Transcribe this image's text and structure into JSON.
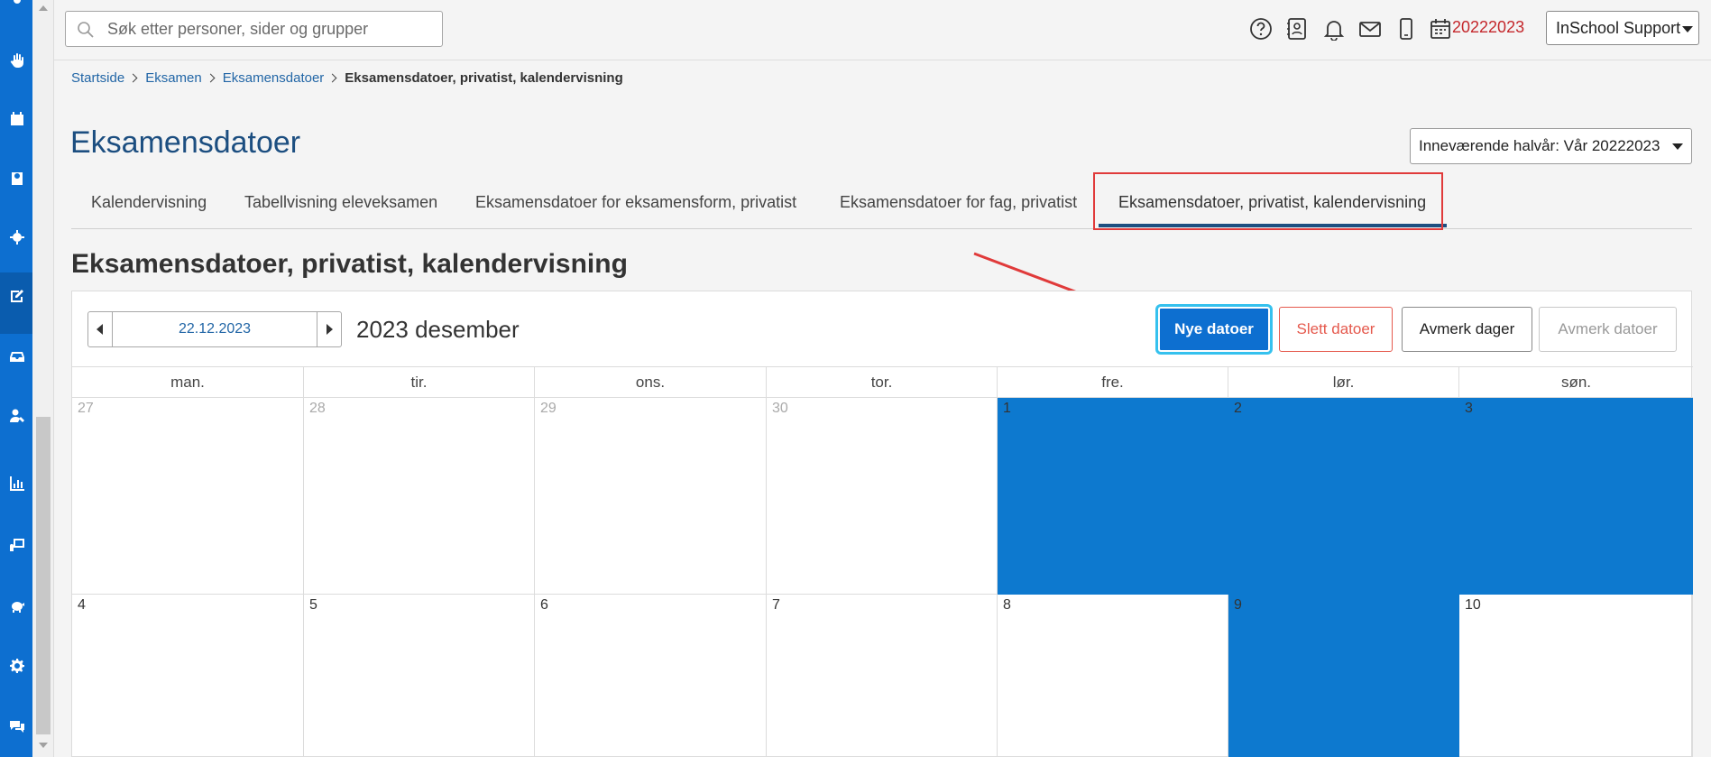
{
  "nav_rail": {
    "icons": [
      "person-raise-icon",
      "hand-icon",
      "calendar-icon",
      "student-book-icon",
      "virus-icon",
      "exam-edit-icon",
      "inbox-icon",
      "user-admin-icon",
      "chart-icon",
      "presentation-icon",
      "piggy-bank-icon",
      "gear-icon",
      "chat-icon"
    ],
    "active": "exam-edit-icon"
  },
  "header": {
    "search_placeholder": "Søk etter personer, sider og grupper",
    "icons": [
      "help-icon",
      "contacts-icon",
      "bell-icon",
      "mail-icon",
      "phone-icon",
      "calendar-icon"
    ],
    "school_year": "20222023",
    "user_menu": "InSchool Support"
  },
  "breadcrumb": {
    "items": [
      "Startside",
      "Eksamen",
      "Eksamensdatoer"
    ],
    "current": "Eksamensdatoer, privatist, kalendervisning"
  },
  "page": {
    "title": "Eksamensdatoer",
    "semester_select": "Inneværende halvår: Vår 20222023"
  },
  "tabs": [
    {
      "label": "Kalendervisning"
    },
    {
      "label": "Tabellvisning eleveksamen"
    },
    {
      "label": "Eksamensdatoer for eksamensform, privatist"
    },
    {
      "label": "Eksamensdatoer for fag, privatist"
    },
    {
      "label": "Eksamensdatoer, privatist, kalendervisning",
      "active": true
    }
  ],
  "section": {
    "title": "Eksamensdatoer, privatist, kalendervisning"
  },
  "calendar": {
    "date_value": "22.12.2023",
    "month_label": "2023 desember",
    "buttons": {
      "new": "Nye datoer",
      "delete": "Slett datoer",
      "mark_days": "Avmerk dager",
      "mark_dates": "Avmerk datoer"
    },
    "weekdays": [
      "man.",
      "tir.",
      "ons.",
      "tor.",
      "fre.",
      "lør.",
      "søn."
    ],
    "weeks": [
      [
        {
          "day": "27",
          "other": true,
          "selected": false
        },
        {
          "day": "28",
          "other": true,
          "selected": false
        },
        {
          "day": "29",
          "other": true,
          "selected": false
        },
        {
          "day": "30",
          "other": true,
          "selected": false
        },
        {
          "day": "1",
          "other": false,
          "selected": true
        },
        {
          "day": "2",
          "other": false,
          "selected": true
        },
        {
          "day": "3",
          "other": false,
          "selected": true
        }
      ],
      [
        {
          "day": "4",
          "other": false,
          "selected": false
        },
        {
          "day": "5",
          "other": false,
          "selected": false
        },
        {
          "day": "6",
          "other": false,
          "selected": false
        },
        {
          "day": "7",
          "other": false,
          "selected": false
        },
        {
          "day": "8",
          "other": false,
          "selected": false
        },
        {
          "day": "9",
          "other": false,
          "selected": true
        },
        {
          "day": "10",
          "other": false,
          "selected": false
        }
      ]
    ]
  },
  "colors": {
    "brand_blue": "#0d6fd0",
    "selected_day": "#0d79cf",
    "title_blue": "#1c4e80",
    "year_red": "#c4282c",
    "annotation_red": "#e03a3a"
  }
}
